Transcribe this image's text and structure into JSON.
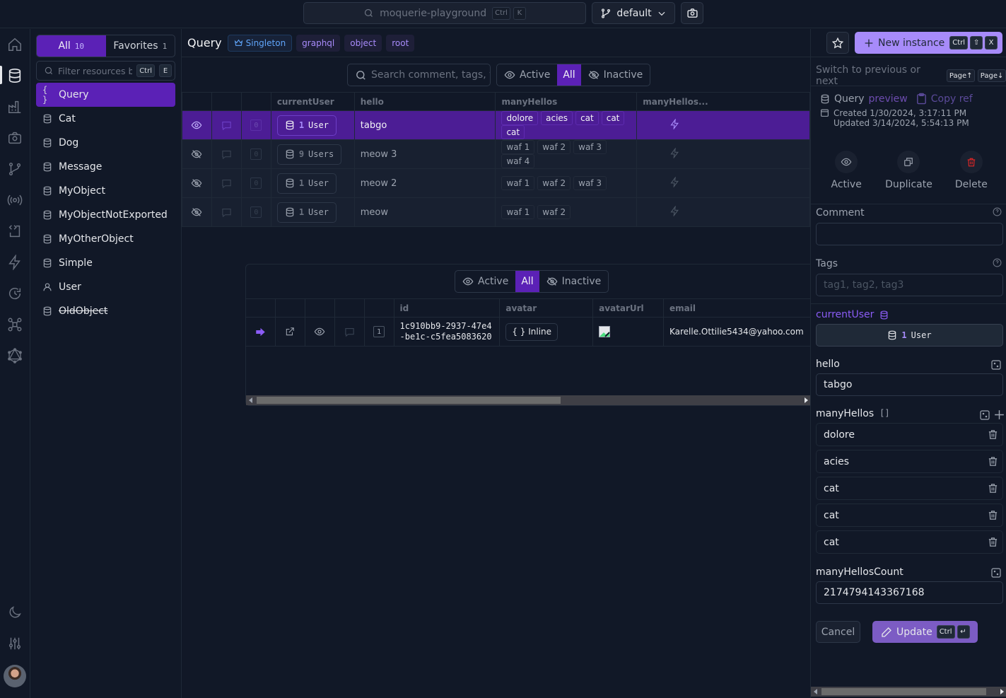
{
  "topbar": {
    "search_text": "moquerie-playground",
    "search_kbd": [
      "Ctrl",
      "K"
    ],
    "branch": "default"
  },
  "rail": {
    "icons": [
      "home-icon",
      "database-icon",
      "factory-icon",
      "camera-icon",
      "git-branch-icon",
      "broadcast-icon",
      "code-file-icon",
      "bolt-icon",
      "history-icon",
      "network-icon",
      "graphql-icon"
    ],
    "bottom_icons": [
      "moon-icon",
      "sliders-icon"
    ]
  },
  "sidebar": {
    "tabs": [
      {
        "label": "All",
        "count": "10"
      },
      {
        "label": "Favorites",
        "count": "1"
      }
    ],
    "filter_placeholder": "Filter resources by",
    "filter_kbd": [
      "Ctrl",
      "E"
    ],
    "items": [
      {
        "label": "Query",
        "icon": "braces",
        "selected": true
      },
      {
        "label": "Cat",
        "icon": "database"
      },
      {
        "label": "Dog",
        "icon": "database"
      },
      {
        "label": "Message",
        "icon": "database"
      },
      {
        "label": "MyObject",
        "icon": "database"
      },
      {
        "label": "MyObjectNotExported",
        "icon": "database"
      },
      {
        "label": "MyOtherObject",
        "icon": "database"
      },
      {
        "label": "Simple",
        "icon": "database"
      },
      {
        "label": "User",
        "icon": "user"
      },
      {
        "label": "OldObject",
        "icon": "database",
        "deprecated": true
      }
    ]
  },
  "main": {
    "title": "Query",
    "chips": [
      "Singleton",
      "graphql",
      "object",
      "root"
    ],
    "search_placeholder": "Search comment, tags, v",
    "filter": {
      "active": "Active",
      "all": "All",
      "inactive": "Inactive"
    },
    "columns": [
      "currentUser",
      "hello",
      "manyHellos",
      "manyHellos..."
    ],
    "rows": [
      {
        "active": true,
        "comments": "0",
        "ref_count": "1",
        "ref_label": "User",
        "hello": "tabgo",
        "manyHellos": [
          "dolore",
          "acies",
          "cat",
          "cat",
          "cat"
        ],
        "selected": true
      },
      {
        "active": false,
        "comments": "0",
        "ref_count": "9",
        "ref_label": "Users",
        "hello": "meow 3",
        "manyHellos": [
          "waf 1",
          "waf 2",
          "waf 3",
          "waf 4"
        ]
      },
      {
        "active": false,
        "comments": "0",
        "ref_count": "1",
        "ref_label": "User",
        "hello": "meow 2",
        "manyHellos": [
          "waf 1",
          "waf 2",
          "waf 3"
        ]
      },
      {
        "active": false,
        "comments": "0",
        "ref_count": "1",
        "ref_label": "User",
        "hello": "meow",
        "manyHellos": [
          "waf 1",
          "waf 2"
        ]
      }
    ],
    "nested": {
      "filter": {
        "active": "Active",
        "all": "All",
        "inactive": "Inactive"
      },
      "columns": [
        "id",
        "avatar",
        "avatarUrl",
        "email"
      ],
      "row": {
        "index": "1",
        "id_line1": "1c910bb9-2937-47e4",
        "id_line2": "-be1c-c5fea5083620",
        "avatar": "{ } Inline",
        "email": "Karelle.Ottilie5434@yahoo.com"
      }
    }
  },
  "right": {
    "new_instance": "New instance",
    "new_instance_kbd": [
      "Ctrl",
      "⇧",
      "X"
    ],
    "switch_text": "Switch to previous or next",
    "switch_kbd": [
      "Page↑",
      "Page↓"
    ],
    "resource": "Query",
    "preview": "preview",
    "copy_ref": "Copy ref",
    "created": "Created 1/30/2024, 3:17:11 PM",
    "updated": "Updated 3/14/2024, 5:54:13 PM",
    "actions": [
      "Active",
      "Duplicate",
      "Delete"
    ],
    "comment_label": "Comment",
    "comment_value": "",
    "tags_label": "Tags",
    "tags_placeholder": "tag1, tag2, tag3",
    "current_user_label": "currentUser",
    "current_user_count": "1",
    "current_user_type": "User",
    "hello_label": "hello",
    "hello_value": "tabgo",
    "many_hellos_label": "manyHellos",
    "many_hellos_suffix": "[]",
    "many_hellos": [
      "dolore",
      "acies",
      "cat",
      "cat",
      "cat"
    ],
    "many_hellos_count_label": "manyHellosCount",
    "many_hellos_count_value": "2174794143367168",
    "cancel": "Cancel",
    "update": "Update",
    "update_kbd": [
      "Ctrl",
      "↵"
    ]
  },
  "colors": {
    "accent": "#5b21b6",
    "accent_light": "#a78bfa",
    "danger": "#dc2626",
    "background": "#111827"
  }
}
